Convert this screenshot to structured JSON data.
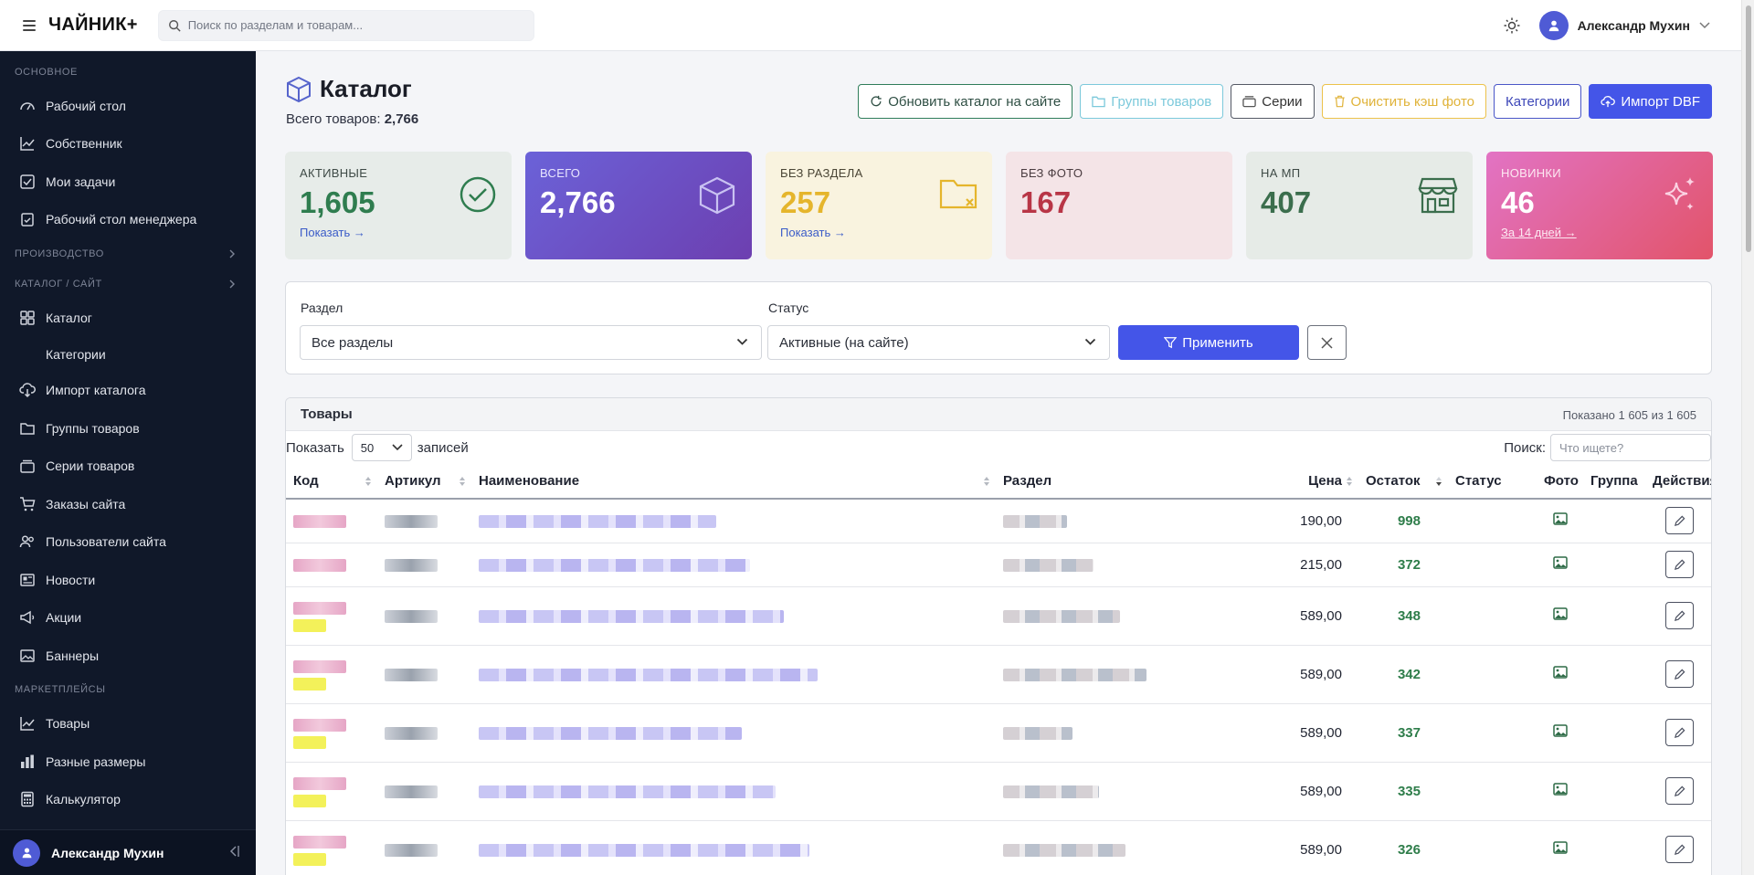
{
  "topbar": {
    "brand": "ЧАЙНИК+",
    "search_placeholder": "Поиск по разделам и товарам...",
    "user_name": "Александр Мухин"
  },
  "sidebar": {
    "sections": [
      {
        "title": "ОСНОВНОЕ",
        "items": [
          "Рабочий стол",
          "Собственник",
          "Мои задачи",
          "Рабочий стол менеджера"
        ]
      },
      {
        "title": "ПРОИЗВОДСТВО"
      },
      {
        "title": "КАТАЛОГ / САЙТ",
        "items": [
          "Каталог",
          "Категории",
          "Импорт каталога",
          "Группы товаров",
          "Серии товаров",
          "Заказы сайта",
          "Пользователи сайта",
          "Новости",
          "Акции",
          "Баннеры"
        ]
      },
      {
        "title": "МАРКЕТПЛЕЙСЫ",
        "items": [
          "Товары",
          "Разные размеры",
          "Калькулятор"
        ]
      }
    ],
    "footer_user": "Александр Мухин"
  },
  "page": {
    "title": "Каталог",
    "total_label": "Всего товаров:",
    "total_value": "2,766",
    "buttons": {
      "refresh": "Обновить каталог на сайте",
      "groups": "Группы товаров",
      "series": "Серии",
      "clear_cache": "Очистить кэш фото",
      "categories": "Категории",
      "import": "Импорт DBF"
    }
  },
  "cards": [
    {
      "label": "АКТИВНЫЕ",
      "value": "1,605",
      "link": "Показать →"
    },
    {
      "label": "ВСЕГО",
      "value": "2,766"
    },
    {
      "label": "БЕЗ РАЗДЕЛА",
      "value": "257",
      "link": "Показать →"
    },
    {
      "label": "БЕЗ ФОТО",
      "value": "167"
    },
    {
      "label": "НА МП",
      "value": "407"
    },
    {
      "label": "НОВИНКИ",
      "value": "46",
      "link": "За 14 дней →"
    }
  ],
  "filters": {
    "section_label": "Раздел",
    "section_value": "Все разделы",
    "status_label": "Статус",
    "status_value": "Активные (на сайте)",
    "apply": "Применить"
  },
  "table": {
    "title": "Товары",
    "shown": "Показано 1 605 из 1 605",
    "show_label": "Показать",
    "page_size": "50",
    "records_label": "записей",
    "search_label": "Поиск:",
    "search_placeholder": "Что ищете?",
    "columns": [
      "Код",
      "Артикул",
      "Наименование",
      "Раздел",
      "Цена",
      "Остаток",
      "Статус",
      "Фото",
      "Группа",
      "Действия"
    ],
    "rows": [
      {
        "price": "190,00",
        "stock": "998"
      },
      {
        "price": "215,00",
        "stock": "372"
      },
      {
        "price": "589,00",
        "stock": "348"
      },
      {
        "price": "589,00",
        "stock": "342"
      },
      {
        "price": "589,00",
        "stock": "337"
      },
      {
        "price": "589,00",
        "stock": "335"
      },
      {
        "price": "589,00",
        "stock": "326"
      }
    ]
  },
  "colors": {
    "sidebar_bg": "#101829",
    "primary": "#4455e8",
    "stock_green": "#2e7d4a"
  }
}
